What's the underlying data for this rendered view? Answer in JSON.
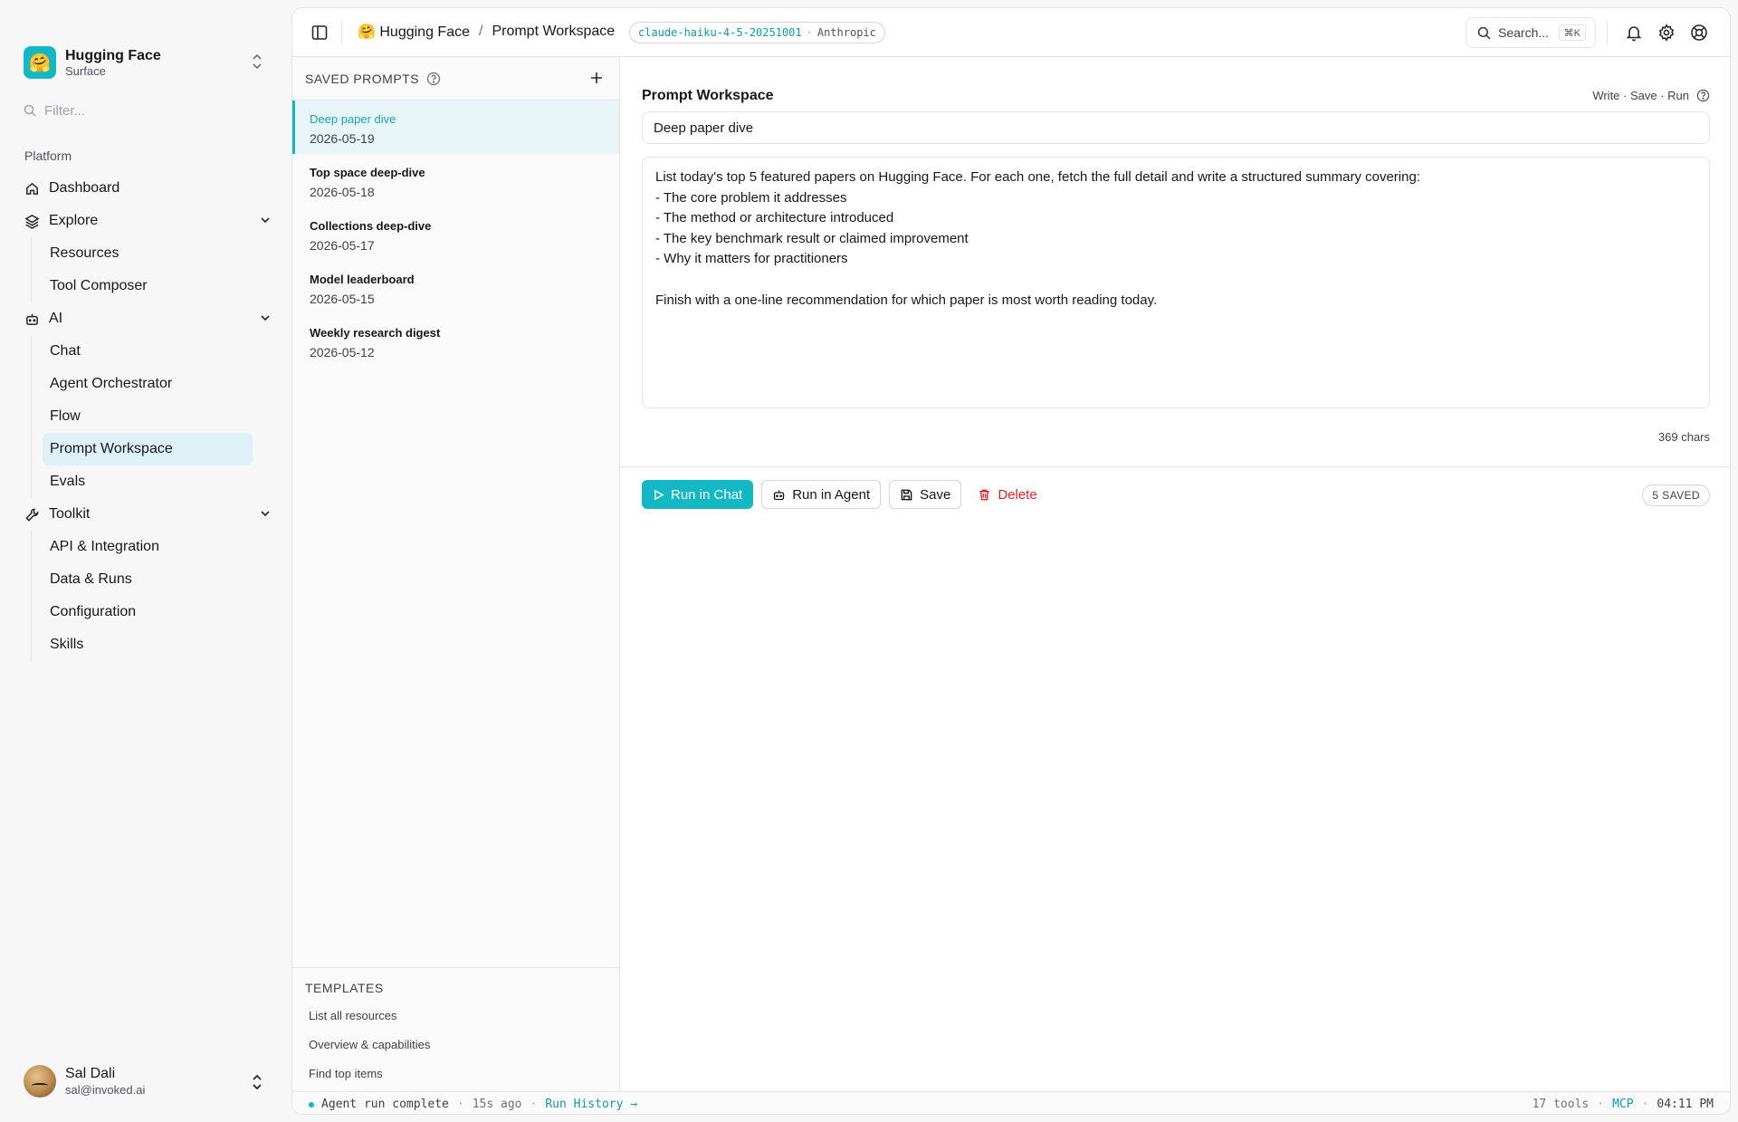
{
  "workspace": {
    "logo": "🤗",
    "name": "Hugging Face",
    "subtitle": "Surface"
  },
  "sidebar": {
    "filter_placeholder": "Filter...",
    "section_label": "Platform",
    "nav": {
      "dashboard": "Dashboard",
      "explore": "Explore",
      "explore_items": [
        "Resources",
        "Tool Composer"
      ],
      "ai": "AI",
      "ai_items": [
        "Chat",
        "Agent Orchestrator",
        "Flow",
        "Prompt Workspace",
        "Evals"
      ],
      "toolkit": "Toolkit",
      "toolkit_items": [
        "API & Integration",
        "Data & Runs",
        "Configuration",
        "Skills"
      ]
    },
    "active_item": "Prompt Workspace",
    "user": {
      "name": "Sal Dali",
      "email": "sal@invoked.ai"
    }
  },
  "topbar": {
    "breadcrumb_root": "🤗 Hugging Face",
    "breadcrumb_sep": "/",
    "breadcrumb_current": "Prompt Workspace",
    "model_name": "claude-haiku-4-5-20251001",
    "model_sep": "·",
    "model_provider": "Anthropic",
    "search_label": "Search...",
    "search_shortcut": "⌘K"
  },
  "saved_prompts": {
    "title": "SAVED PROMPTS",
    "items": [
      {
        "title": "Deep paper dive",
        "date": "2026-05-19",
        "active": true
      },
      {
        "title": "Top space deep-dive",
        "date": "2026-05-18"
      },
      {
        "title": "Collections deep-dive",
        "date": "2026-05-17"
      },
      {
        "title": "Model leaderboard",
        "date": "2026-05-15"
      },
      {
        "title": "Weekly research digest",
        "date": "2026-05-12"
      }
    ]
  },
  "templates": {
    "title": "TEMPLATES",
    "items": [
      "List all resources",
      "Overview & capabilities",
      "Find top items"
    ]
  },
  "editor": {
    "title": "Prompt Workspace",
    "hint": "Write · Save · Run",
    "name_value": "Deep paper dive",
    "body_value": "List today's top 5 featured papers on Hugging Face. For each one, fetch the full detail and write a structured summary covering:\n- The core problem it addresses\n- The method or architecture introduced\n- The key benchmark result or claimed improvement\n- Why it matters for practitioners\n\nFinish with a one-line recommendation for which paper is most worth reading today.",
    "char_count": "369 chars",
    "buttons": {
      "run_chat": "Run in Chat",
      "run_agent": "Run in Agent",
      "save": "Save",
      "delete": "Delete"
    },
    "saved_badge": "5 SAVED"
  },
  "statusbar": {
    "message": "Agent run complete",
    "sep": "·",
    "ago": "15s ago",
    "link": "Run History →",
    "tools": "17 tools",
    "mcp": "MCP",
    "time": "04:11 PM"
  },
  "colors": {
    "accent": "#14b8c4",
    "danger": "#dc2626",
    "active_bg": "#ddf1f6"
  }
}
